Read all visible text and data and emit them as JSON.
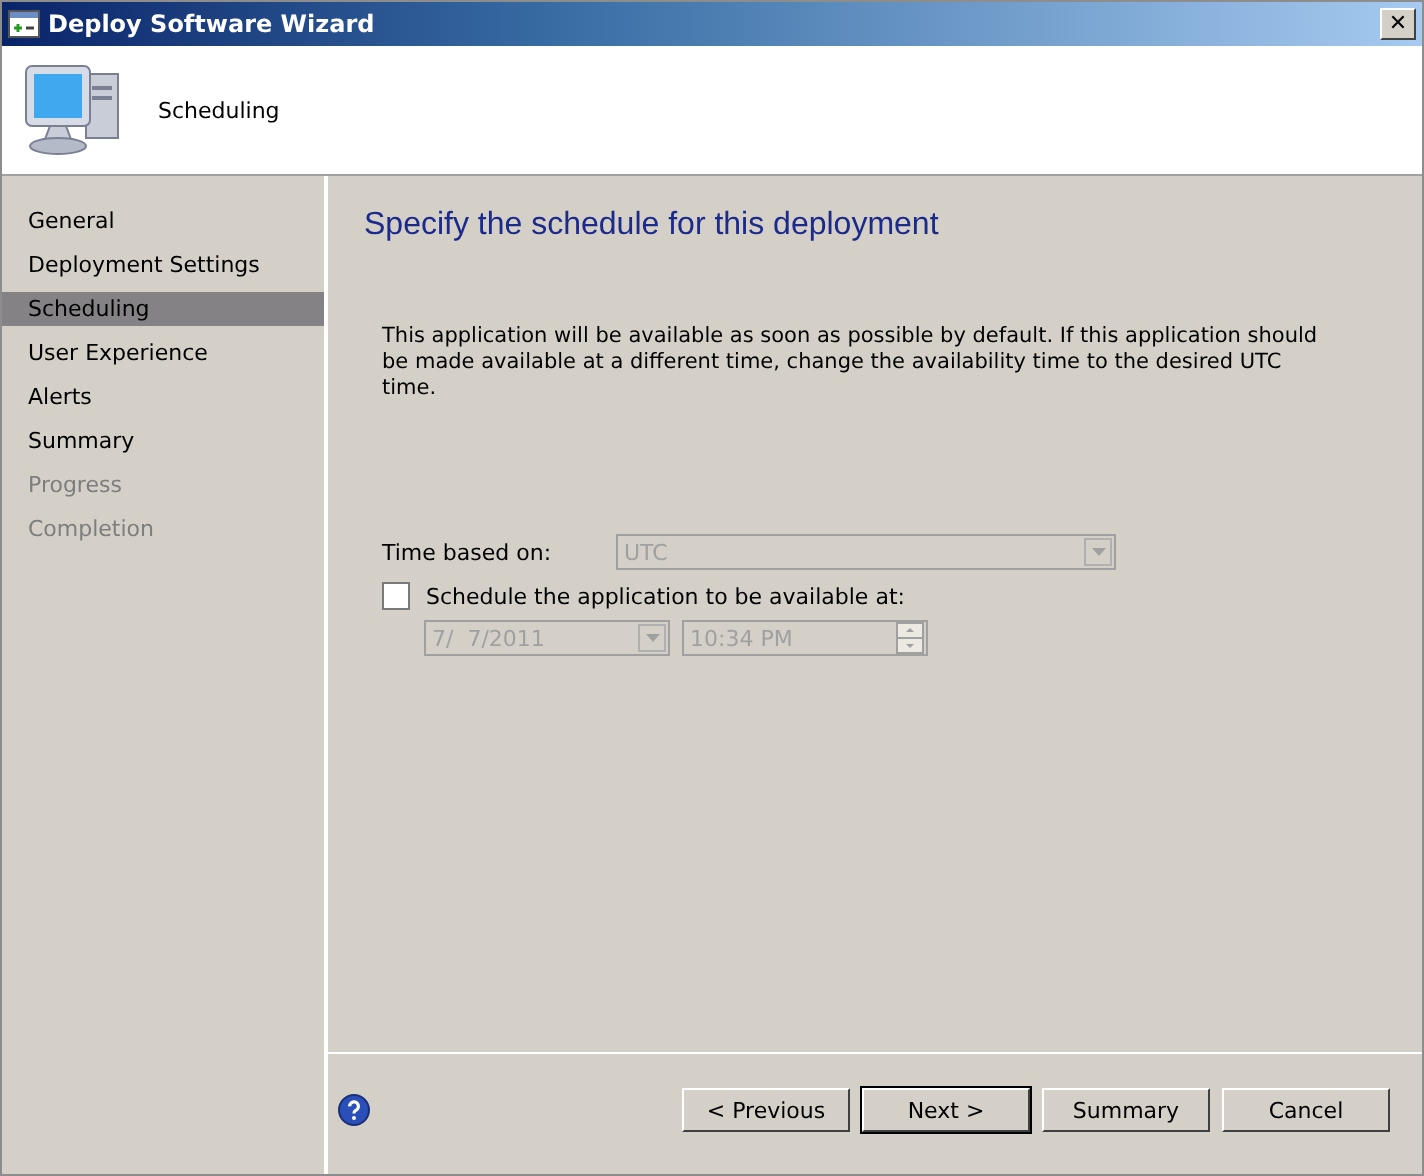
{
  "window": {
    "title": "Deploy Software Wizard",
    "close": "✕"
  },
  "header": {
    "title": "Scheduling"
  },
  "sidebar": {
    "items": [
      {
        "label": "General",
        "selected": false,
        "disabled": false
      },
      {
        "label": "Deployment Settings",
        "selected": false,
        "disabled": false
      },
      {
        "label": "Scheduling",
        "selected": true,
        "disabled": false
      },
      {
        "label": "User Experience",
        "selected": false,
        "disabled": false
      },
      {
        "label": "Alerts",
        "selected": false,
        "disabled": false
      },
      {
        "label": "Summary",
        "selected": false,
        "disabled": false
      },
      {
        "label": "Progress",
        "selected": false,
        "disabled": true
      },
      {
        "label": "Completion",
        "selected": false,
        "disabled": true
      }
    ]
  },
  "content": {
    "heading": "Specify the schedule for this deployment",
    "description": "This application will be available as soon as possible by default. If this application should be made available at a different time, change the availability time to the desired UTC time.",
    "time_based_on": {
      "label": "Time based on:",
      "value": "UTC",
      "disabled": true
    },
    "schedule": {
      "label": "Schedule the application to be available at:",
      "checked": false
    },
    "date": {
      "value": "7/  7/2011",
      "disabled": true
    },
    "time": {
      "value": "10:34 PM",
      "disabled": true
    }
  },
  "buttons": [
    {
      "label": "< Previous",
      "default": false
    },
    {
      "label": "Next >",
      "default": true
    },
    {
      "label": "Summary",
      "default": false
    },
    {
      "label": "Cancel",
      "default": false
    }
  ]
}
